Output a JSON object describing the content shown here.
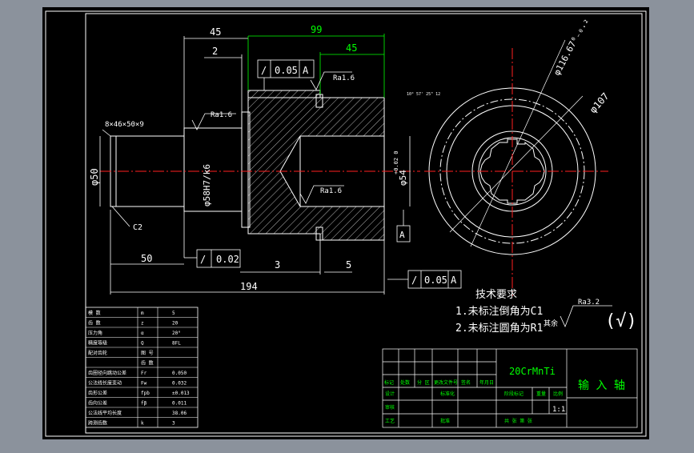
{
  "drawing": {
    "dims": {
      "d45_top": "45",
      "d99": "99",
      "d45_inner": "45",
      "d2": "2",
      "d50_bottom": "50",
      "d3": "3",
      "d5": "5",
      "d194": "194",
      "dia50": "φ50",
      "dia58": "φ58H7/k6",
      "dia54": "φ54",
      "dia54_tol": "+0.02 0",
      "dia116": "φ116.67⁰₋₀.₂",
      "dia107": "φ107",
      "c2": "C2",
      "spline": "8×46×50×9",
      "tiny_note": "10° 57' 25\" 12"
    },
    "roughness": {
      "ra16_a": "Ra1.6",
      "ra16_b": "Ra1.6",
      "ra16_c": "Ra1.6",
      "other_prefix": "其余",
      "other_value": "Ra3.2"
    },
    "tolerance_frames": {
      "top": {
        "symbol": "/",
        "value": "0.05",
        "datum": "A"
      },
      "left": {
        "symbol": "/",
        "value": "0.02"
      },
      "bottom": {
        "symbol": "/",
        "value": "0.05",
        "datum": "A"
      },
      "datum_label": "A"
    },
    "notes": {
      "title": "技术要求",
      "line1": "1.未标注倒角为C1",
      "line2": "2.未标注圆角为R1"
    },
    "param_table": {
      "rows": [
        {
          "name": "模  数",
          "sym": "m",
          "val": "5"
        },
        {
          "name": "齿  数",
          "sym": "z",
          "val": "20"
        },
        {
          "name": "压力角",
          "sym": "α",
          "val": "20°"
        },
        {
          "name": "精度等级",
          "sym": "Q",
          "val": "8FL"
        },
        {
          "name": "配对齿轮",
          "sym": "图 号",
          "val": ""
        },
        {
          "name": "",
          "sym": "齿 数",
          "val": ""
        },
        {
          "name": "齿圈径向跳动公差",
          "sym": "Fr",
          "val": "0.050"
        },
        {
          "name": "公法线长度变动",
          "sym": "Fw",
          "val": "0.032"
        },
        {
          "name": "齿形公差",
          "sym": "fpb",
          "val": "±0.013"
        },
        {
          "name": "齿向公差",
          "sym": "fβ",
          "val": "0.011"
        },
        {
          "name": "公法线平均长度",
          "sym": "",
          "val": "38.06"
        },
        {
          "name": "跨测齿数",
          "sym": "k",
          "val": "3"
        }
      ]
    },
    "title_block": {
      "material": "20CrMnTi",
      "part_name": "输 入 轴",
      "scale": "1:1",
      "row_labels": [
        "标记",
        "处数",
        "分 区",
        "更改文件号",
        "签名",
        "年月日"
      ],
      "left_labels": [
        "设计",
        "审核",
        "工艺"
      ],
      "mid_labels": [
        "标准化",
        "批准"
      ],
      "stage_labels": [
        "阶段标记",
        "重量",
        "比例"
      ],
      "sheet_labels": [
        "共 张 第 张"
      ]
    }
  }
}
